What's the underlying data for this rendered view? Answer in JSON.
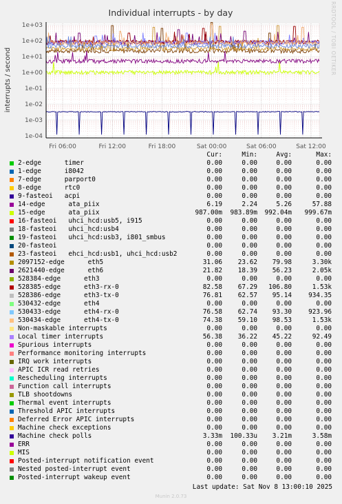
{
  "chart_data": {
    "type": "line",
    "title": "Individual interrupts - by day",
    "ylabel": "interrupts / second",
    "yscale": "log",
    "ylim": [
      0.0001,
      1000
    ],
    "y_ticks": [
      "1e+03",
      "1e+02",
      "1e+01",
      "1e+00",
      "1e-01",
      "1e-02",
      "1e-03",
      "1e-04"
    ],
    "x_ticks": [
      "Fri 06:00",
      "Fri 12:00",
      "Fri 18:00",
      "Sat 00:00",
      "Sat 06:00",
      "Sat 12:00"
    ],
    "x_range_hours": [
      -33,
      0
    ],
    "grid": true,
    "series": [
      {
        "name": "2621440-edge eth6",
        "color": "#7a3c00",
        "base": 22,
        "spikes": [
          [
            8,
            900
          ],
          [
            14,
            600
          ],
          [
            20,
            1400
          ],
          [
            27,
            300
          ]
        ]
      },
      {
        "name": "2097152-edge eth5",
        "color": "#cc9933",
        "base": 30,
        "spikes": [
          [
            13,
            700
          ],
          [
            21,
            800
          ],
          [
            28,
            900
          ]
        ]
      },
      {
        "name": "528386-edge eth3-tx-0",
        "color": "#730073",
        "base": 76,
        "spikes": [
          [
            4,
            300
          ],
          [
            16,
            500
          ],
          [
            24,
            400
          ]
        ]
      },
      {
        "name": "528385-edge eth3-rx-0",
        "color": "#990000",
        "base": 82,
        "spikes": [
          [
            10,
            300
          ],
          [
            19,
            600
          ],
          [
            30,
            800
          ]
        ]
      },
      {
        "name": "530433-edge eth4-rx-0",
        "color": "#8080ff",
        "base": 72,
        "spikes": [
          [
            6,
            200
          ],
          [
            17,
            300
          ]
        ]
      },
      {
        "name": "530434-edge eth4-tx-0",
        "color": "#f0a868",
        "base": 70,
        "spikes": [
          [
            9,
            400
          ],
          [
            20,
            1100
          ],
          [
            31,
            700
          ]
        ]
      },
      {
        "name": "Local timer interrupts",
        "color": "#6a8ade",
        "base": 45,
        "spikes": []
      },
      {
        "name": "14-edge ata_piix",
        "color": "#800080",
        "base": 5,
        "spikes": []
      },
      {
        "name": "15-edge ata_piix",
        "color": "#ccff00",
        "base": 0.99,
        "spikes": []
      },
      {
        "name": "Machine check polls",
        "color": "#000080",
        "base": 0.0033,
        "dips": true
      }
    ]
  },
  "legend_header": {
    "cur": "Cur:",
    "min": "Min:",
    "avg": "Avg:",
    "max": "Max:"
  },
  "legend": [
    {
      "label": "2-edge      timer",
      "color": "#00cc00",
      "cur": "0.00",
      "min": "0.00",
      "avg": "0.00",
      "max": "0.00"
    },
    {
      "label": "1-edge      i8042",
      "color": "#0066b3",
      "cur": "0.00",
      "min": "0.00",
      "avg": "0.00",
      "max": "0.00"
    },
    {
      "label": "7-edge      parport0",
      "color": "#ff8000",
      "cur": "0.00",
      "min": "0.00",
      "avg": "0.00",
      "max": "0.00"
    },
    {
      "label": "8-edge      rtc0",
      "color": "#ffcc00",
      "cur": "0.00",
      "min": "0.00",
      "avg": "0.00",
      "max": "0.00"
    },
    {
      "label": "9-fasteoi   acpi",
      "color": "#330099",
      "cur": "0.00",
      "min": "0.00",
      "avg": "0.00",
      "max": "0.00"
    },
    {
      "label": "14-edge      ata_piix",
      "color": "#990099",
      "cur": "6.19",
      "min": "2.24",
      "avg": "5.26",
      "max": "57.88"
    },
    {
      "label": "15-edge      ata_piix",
      "color": "#ccff00",
      "cur": "987.00m",
      "min": "983.89m",
      "avg": "992.04m",
      "max": "999.67m"
    },
    {
      "label": "16-fasteoi   uhci_hcd:usb5, i915",
      "color": "#ff0000",
      "cur": "0.00",
      "min": "0.00",
      "avg": "0.00",
      "max": "0.00"
    },
    {
      "label": "18-fasteoi   uhci_hcd:usb4",
      "color": "#808080",
      "cur": "0.00",
      "min": "0.00",
      "avg": "0.00",
      "max": "0.00"
    },
    {
      "label": "19-fasteoi   uhci_hcd:usb3, i801_smbus",
      "color": "#008f00",
      "cur": "0.00",
      "min": "0.00",
      "avg": "0.00",
      "max": "0.00"
    },
    {
      "label": "20-fasteoi",
      "color": "#00487d",
      "cur": "0.00",
      "min": "0.00",
      "avg": "0.00",
      "max": "0.00"
    },
    {
      "label": "23-fasteoi   ehci_hcd:usb1, uhci_hcd:usb2",
      "color": "#b35a00",
      "cur": "0.00",
      "min": "0.00",
      "avg": "0.00",
      "max": "0.00"
    },
    {
      "label": "2097152-edge      eth5",
      "color": "#b38f00",
      "cur": "31.06",
      "min": "23.62",
      "avg": "79.98",
      "max": "3.30k"
    },
    {
      "label": "2621440-edge      eth6",
      "color": "#6b006b",
      "cur": "21.82",
      "min": "18.39",
      "avg": "56.23",
      "max": "2.05k"
    },
    {
      "label": "528384-edge      eth3",
      "color": "#8fb300",
      "cur": "0.00",
      "min": "0.00",
      "avg": "0.00",
      "max": "0.00"
    },
    {
      "label": "528385-edge      eth3-rx-0",
      "color": "#b30000",
      "cur": "82.58",
      "min": "67.29",
      "avg": "106.80",
      "max": "1.53k"
    },
    {
      "label": "528386-edge      eth3-tx-0",
      "color": "#bebebe",
      "cur": "76.81",
      "min": "62.57",
      "avg": "95.14",
      "max": "934.35"
    },
    {
      "label": "530432-edge      eth4",
      "color": "#80ff80",
      "cur": "0.00",
      "min": "0.00",
      "avg": "0.00",
      "max": "0.00"
    },
    {
      "label": "530433-edge      eth4-rx-0",
      "color": "#80c9ff",
      "cur": "76.58",
      "min": "62.74",
      "avg": "93.30",
      "max": "923.96"
    },
    {
      "label": "530434-edge      eth4-tx-0",
      "color": "#ffc080",
      "cur": "74.38",
      "min": "59.10",
      "avg": "98.53",
      "max": "1.53k"
    },
    {
      "label": "Non-maskable interrupts",
      "color": "#ffe680",
      "cur": "0.00",
      "min": "0.00",
      "avg": "0.00",
      "max": "0.00"
    },
    {
      "label": "Local timer interrupts",
      "color": "#aa80ff",
      "cur": "56.38",
      "min": "36.22",
      "avg": "45.22",
      "max": "92.49"
    },
    {
      "label": "Spurious interrupts",
      "color": "#ee00cc",
      "cur": "0.00",
      "min": "0.00",
      "avg": "0.00",
      "max": "0.00"
    },
    {
      "label": "Performance monitoring interrupts",
      "color": "#ff8080",
      "cur": "0.00",
      "min": "0.00",
      "avg": "0.00",
      "max": "0.00"
    },
    {
      "label": "IRQ work interrupts",
      "color": "#666600",
      "cur": "0.00",
      "min": "0.00",
      "avg": "0.00",
      "max": "0.00"
    },
    {
      "label": "APIC ICR read retries",
      "color": "#ffbfff",
      "cur": "0.00",
      "min": "0.00",
      "avg": "0.00",
      "max": "0.00"
    },
    {
      "label": "Rescheduling interrupts",
      "color": "#00ffcc",
      "cur": "0.00",
      "min": "0.00",
      "avg": "0.00",
      "max": "0.00"
    },
    {
      "label": "Function call interrupts",
      "color": "#cc6699",
      "cur": "0.00",
      "min": "0.00",
      "avg": "0.00",
      "max": "0.00"
    },
    {
      "label": "TLB shootdowns",
      "color": "#999900",
      "cur": "0.00",
      "min": "0.00",
      "avg": "0.00",
      "max": "0.00"
    },
    {
      "label": "Thermal event interrupts",
      "color": "#00cc00",
      "cur": "0.00",
      "min": "0.00",
      "avg": "0.00",
      "max": "0.00"
    },
    {
      "label": "Threshold APIC interrupts",
      "color": "#0066b3",
      "cur": "0.00",
      "min": "0.00",
      "avg": "0.00",
      "max": "0.00"
    },
    {
      "label": "Deferred Error APIC interrupts",
      "color": "#ff8000",
      "cur": "0.00",
      "min": "0.00",
      "avg": "0.00",
      "max": "0.00"
    },
    {
      "label": "Machine check exceptions",
      "color": "#ffcc00",
      "cur": "0.00",
      "min": "0.00",
      "avg": "0.00",
      "max": "0.00"
    },
    {
      "label": "Machine check polls",
      "color": "#330099",
      "cur": "3.33m",
      "min": "100.33u",
      "avg": "3.21m",
      "max": "3.58m"
    },
    {
      "label": "ERR",
      "color": "#990099",
      "cur": "0.00",
      "min": "0.00",
      "avg": "0.00",
      "max": "0.00"
    },
    {
      "label": "MIS",
      "color": "#ccff00",
      "cur": "0.00",
      "min": "0.00",
      "avg": "0.00",
      "max": "0.00"
    },
    {
      "label": "Posted-interrupt notification event",
      "color": "#ff0000",
      "cur": "0.00",
      "min": "0.00",
      "avg": "0.00",
      "max": "0.00"
    },
    {
      "label": "Nested posted-interrupt event",
      "color": "#808080",
      "cur": "0.00",
      "min": "0.00",
      "avg": "0.00",
      "max": "0.00"
    },
    {
      "label": "Posted-interrupt wakeup event",
      "color": "#008f00",
      "cur": "0.00",
      "min": "0.00",
      "avg": "0.00",
      "max": "0.00"
    }
  ],
  "footer": {
    "last_update": "Last update: Sat Nov  8 13:00:10 2025",
    "munin": "Munin 2.0.73",
    "rrd": "RRDTOOL / TOBI OETIKER"
  }
}
